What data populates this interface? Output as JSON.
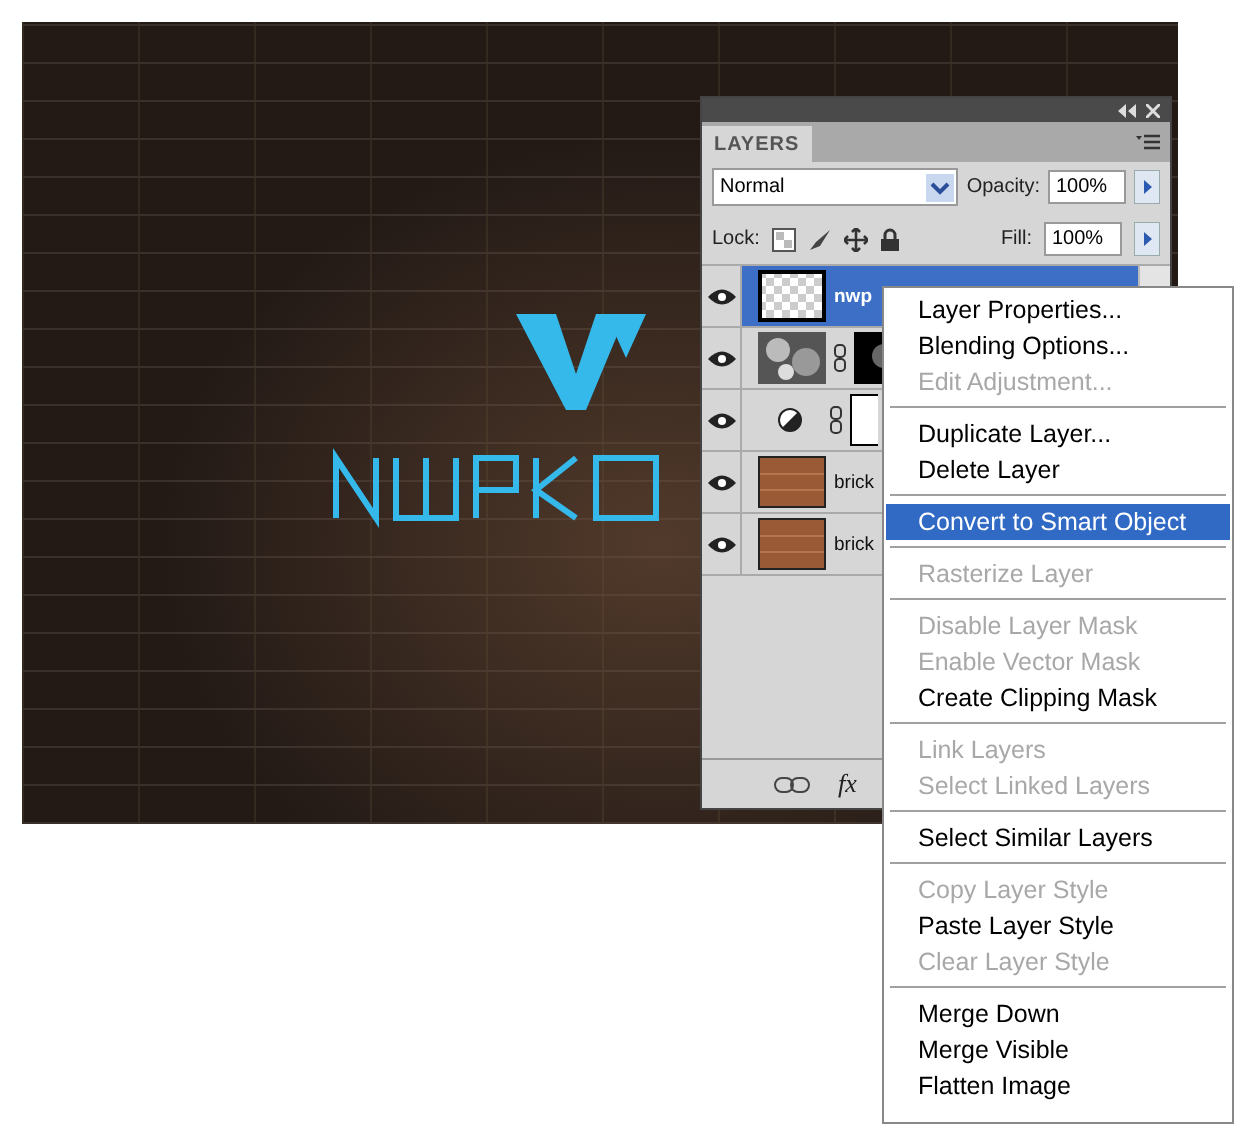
{
  "layers_panel": {
    "title": "LAYERS",
    "blend_mode": "Normal",
    "opacity_label": "Opacity:",
    "opacity": "100%",
    "lock_label": "Lock:",
    "fill_label": "Fill:",
    "fill": "100%",
    "fx_button": "fx",
    "layers": [
      {
        "name": "nwp",
        "kind": "transparent",
        "visible": true,
        "selected": true
      },
      {
        "kind": "masked",
        "visible": true,
        "selected": false
      },
      {
        "kind": "adjustment",
        "visible": true,
        "selected": false
      },
      {
        "name": "brick",
        "kind": "texture",
        "visible": true,
        "selected": false
      },
      {
        "name": "brick",
        "kind": "texture",
        "visible": true,
        "selected": false
      }
    ]
  },
  "context_menu": {
    "groups": [
      [
        {
          "label": "Layer Properties...",
          "disabled": false,
          "selected": false
        },
        {
          "label": "Blending Options...",
          "disabled": false,
          "selected": false
        },
        {
          "label": "Edit Adjustment...",
          "disabled": true,
          "selected": false
        }
      ],
      [
        {
          "label": "Duplicate Layer...",
          "disabled": false,
          "selected": false
        },
        {
          "label": "Delete Layer",
          "disabled": false,
          "selected": false
        }
      ],
      [
        {
          "label": "Convert to Smart Object",
          "disabled": false,
          "selected": true
        }
      ],
      [
        {
          "label": "Rasterize Layer",
          "disabled": true,
          "selected": false
        }
      ],
      [
        {
          "label": "Disable Layer Mask",
          "disabled": true,
          "selected": false
        },
        {
          "label": "Enable Vector Mask",
          "disabled": true,
          "selected": false
        },
        {
          "label": "Create Clipping Mask",
          "disabled": false,
          "selected": false
        }
      ],
      [
        {
          "label": "Link Layers",
          "disabled": true,
          "selected": false
        },
        {
          "label": "Select Linked Layers",
          "disabled": true,
          "selected": false
        }
      ],
      [
        {
          "label": "Select Similar Layers",
          "disabled": false,
          "selected": false
        }
      ],
      [
        {
          "label": "Copy Layer Style",
          "disabled": true,
          "selected": false
        },
        {
          "label": "Paste Layer Style",
          "disabled": false,
          "selected": false
        },
        {
          "label": "Clear Layer Style",
          "disabled": true,
          "selected": false
        }
      ],
      [
        {
          "label": "Merge Down",
          "disabled": false,
          "selected": false
        },
        {
          "label": "Merge Visible",
          "disabled": false,
          "selected": false
        },
        {
          "label": "Flatten Image",
          "disabled": false,
          "selected": false
        }
      ]
    ]
  }
}
